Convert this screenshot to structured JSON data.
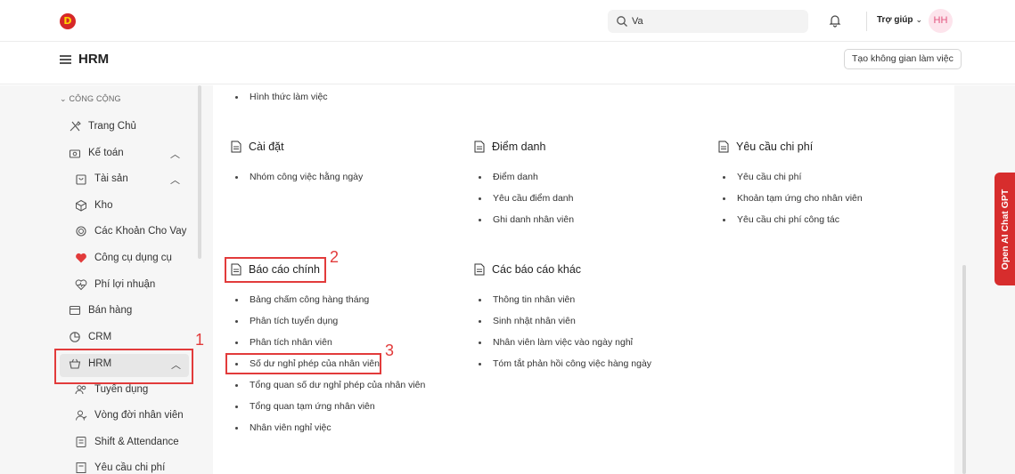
{
  "navbar": {
    "logo_letter": "D",
    "search_value": "Va",
    "help_label": "Trợ giúp",
    "avatar_initials": "HH"
  },
  "header": {
    "title": "HRM",
    "workspace_button": "Tạo không gian làm việc"
  },
  "sidebar": {
    "section_label": "CÔNG CỘNG",
    "items": [
      {
        "label": "Trang Chủ",
        "icon": "tools-icon"
      },
      {
        "label": "Kế toán",
        "icon": "register-icon"
      },
      {
        "label": "Tài sản",
        "icon": "bag-icon"
      },
      {
        "label": "Kho",
        "icon": "box-icon"
      },
      {
        "label": "Các Khoản Cho Vay",
        "icon": "coin-icon"
      },
      {
        "label": "Công cụ dụng cụ",
        "icon": "heart-icon"
      },
      {
        "label": "Phí lợi nhuận",
        "icon": "heartbeat-icon"
      },
      {
        "label": "Bán hàng",
        "icon": "card-icon"
      },
      {
        "label": "CRM",
        "icon": "pie-icon"
      },
      {
        "label": "HRM",
        "icon": "basket-icon"
      },
      {
        "label": "Tuyển dụng",
        "icon": "users-icon"
      },
      {
        "label": "Vòng đời nhân viên",
        "icon": "user-icon"
      },
      {
        "label": "Shift & Attendance",
        "icon": "list-icon"
      },
      {
        "label": "Yêu cầu chi phí",
        "icon": "receipt-icon"
      }
    ]
  },
  "content": {
    "top_link": "Hình thức làm việc",
    "sections": [
      {
        "title": "Cài đặt",
        "links": [
          "Nhóm công việc hằng ngày"
        ]
      },
      {
        "title": "Điểm danh",
        "links": [
          "Điểm danh",
          "Yêu cầu điểm danh",
          "Ghi danh nhân viên"
        ]
      },
      {
        "title": "Yêu cầu chi phí",
        "links": [
          "Yêu cầu chi phí",
          "Khoản tạm ứng cho nhân viên",
          "Yêu cầu chi phí công tác"
        ]
      },
      {
        "title": "Báo cáo chính",
        "links": [
          "Bảng chấm công hàng tháng",
          "Phân tích tuyển dụng",
          "Phân tích nhân viên",
          "Số dư nghỉ phép của nhân viên",
          "Tổng quan số dư nghỉ phép của nhân viên",
          "Tổng quan tạm ứng nhân viên",
          "Nhân viên nghỉ việc"
        ]
      },
      {
        "title": "Các báo cáo khác",
        "links": [
          "Thông tin nhân viên",
          "Sinh nhật nhân viên",
          "Nhân viên làm việc vào ngày nghỉ",
          "Tóm tắt phản hồi công việc hàng ngày"
        ]
      }
    ]
  },
  "annotations": [
    "1",
    "2",
    "3"
  ],
  "side_tab": "Open AI Chat GPT",
  "colors": {
    "highlight": "#e23b3b",
    "gpt_tab": "#d72d2d",
    "avatar_bg": "#fde4ec"
  }
}
